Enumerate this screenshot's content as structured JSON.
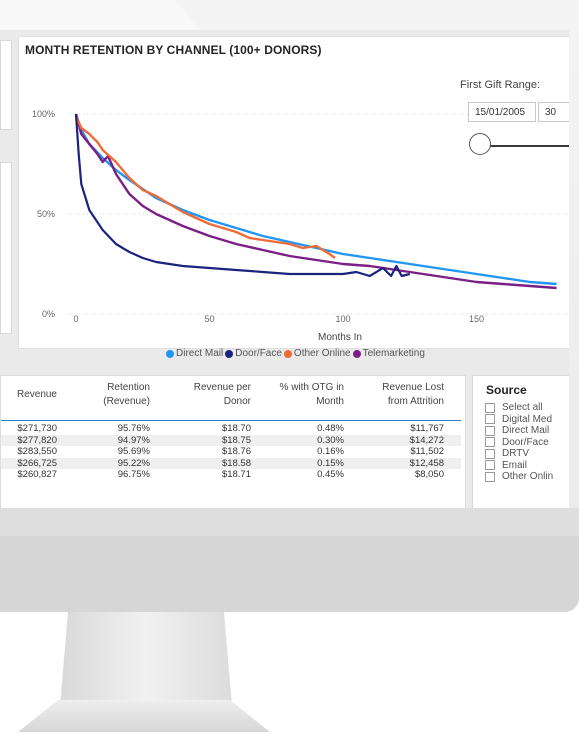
{
  "chart": {
    "title": "MONTH RETENTION BY CHANNEL (100+ DONORS)",
    "y_ticks": [
      "100%",
      "50%",
      "0%"
    ],
    "x_ticks": [
      "0",
      "50",
      "100",
      "150"
    ],
    "x_label": "Months In",
    "legend": [
      {
        "name": "Direct Mail",
        "color": "#2196f3"
      },
      {
        "name": "Door/Face",
        "color": "#1a237e"
      },
      {
        "name": "Other Online",
        "color": "#ef6c36"
      },
      {
        "name": "Telemarketing",
        "color": "#7b1f86"
      }
    ]
  },
  "slicer": {
    "label": "First Gift Range:",
    "date_start": "15/01/2005",
    "date_end": "30"
  },
  "chart_data": {
    "type": "line",
    "xlabel": "Months In",
    "xlim": [
      -5,
      180
    ],
    "ylim": [
      0,
      100
    ],
    "series": [
      {
        "name": "Direct Mail",
        "x": [
          0,
          2,
          5,
          10,
          15,
          20,
          30,
          40,
          50,
          60,
          70,
          80,
          90,
          100,
          110,
          120,
          130,
          140,
          150,
          160,
          170,
          180
        ],
        "values": [
          100,
          92,
          85,
          78,
          72,
          67,
          58,
          52,
          47,
          43,
          39,
          36,
          33,
          30,
          28,
          26,
          24,
          22,
          20,
          18,
          16,
          15
        ]
      },
      {
        "name": "Door/Face",
        "x": [
          0,
          1,
          2,
          5,
          10,
          15,
          20,
          25,
          30,
          40,
          50,
          60,
          70,
          80,
          90,
          100,
          105,
          110,
          115,
          118,
          120,
          122,
          125
        ],
        "values": [
          100,
          80,
          65,
          52,
          42,
          35,
          31,
          28,
          26,
          24,
          23,
          22,
          21,
          20,
          20,
          20,
          21,
          19,
          23,
          19,
          24,
          19,
          20
        ]
      },
      {
        "name": "Other Online",
        "x": [
          0,
          2,
          5,
          8,
          10,
          15,
          20,
          25,
          30,
          35,
          40,
          45,
          50,
          55,
          60,
          65,
          70,
          75,
          80,
          85,
          90,
          95,
          97
        ],
        "values": [
          99,
          93,
          90,
          86,
          82,
          76,
          68,
          62,
          59,
          55,
          51,
          48,
          45,
          43,
          41,
          38,
          37,
          36,
          35,
          33,
          34,
          30,
          28
        ]
      },
      {
        "name": "Telemarketing",
        "x": [
          0,
          2,
          5,
          8,
          10,
          12,
          15,
          20,
          25,
          30,
          40,
          50,
          60,
          70,
          80,
          90,
          100,
          110,
          120,
          130,
          140,
          150,
          160,
          170,
          180
        ],
        "values": [
          100,
          90,
          85,
          80,
          76,
          79,
          70,
          60,
          54,
          50,
          44,
          39,
          35,
          32,
          29,
          27,
          25,
          24,
          22,
          20,
          18,
          16,
          15,
          14,
          13
        ]
      }
    ]
  },
  "table": {
    "headers": [
      "Revenue",
      "Retention (Revenue)",
      "Revenue per Donor",
      "% with OTG in Month",
      "Revenue Lost from Attrition"
    ],
    "rows": [
      [
        "$271,730",
        "95.76%",
        "$18.70",
        "0.48%",
        "$11,767"
      ],
      [
        "$277,820",
        "94.97%",
        "$18.75",
        "0.30%",
        "$14,272"
      ],
      [
        "$283,550",
        "95.69%",
        "$18.76",
        "0.16%",
        "$11,502"
      ],
      [
        "$266,725",
        "95.22%",
        "$18.58",
        "0.15%",
        "$12,458"
      ],
      [
        "$260,827",
        "96.75%",
        "$18.71",
        "0.45%",
        "$8,050"
      ]
    ]
  },
  "source": {
    "title": "Source",
    "items": [
      "Select all",
      "Digital Med",
      "Direct Mail",
      "Door/Face",
      "DRTV",
      "Email",
      "Other Onlin"
    ]
  }
}
